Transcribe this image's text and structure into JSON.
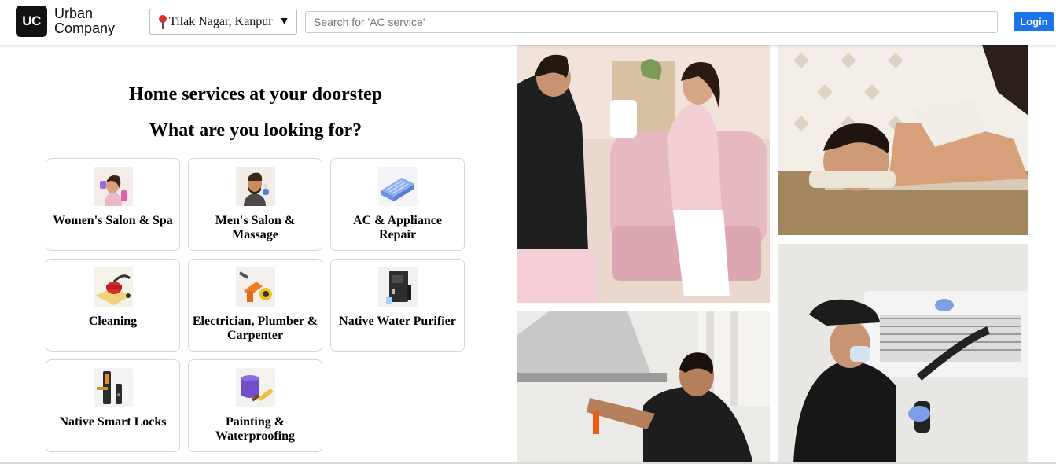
{
  "header": {
    "logo_mark": "UC",
    "logo_line1": "Urban",
    "logo_line2": "Company",
    "location": "Tilak Nagar, Kanpur",
    "location_caret": "▼",
    "search_placeholder": "Search for 'AC service'",
    "login_label": "Login"
  },
  "main": {
    "heading": "Home services at your doorstep",
    "subheading": "What are you looking for?"
  },
  "categories": [
    {
      "label": "Women's Salon & Spa",
      "icon": "women-salon-icon"
    },
    {
      "label": "Men's Salon & Massage",
      "icon": "men-salon-icon"
    },
    {
      "label": "AC & Appliance Repair",
      "icon": "ac-repair-icon"
    },
    {
      "label": "Cleaning",
      "icon": "cleaning-icon"
    },
    {
      "label": "Electrician, Plumber & Carpenter",
      "icon": "electrician-tools-icon"
    },
    {
      "label": "Native Water Purifier",
      "icon": "water-purifier-icon"
    },
    {
      "label": "Native Smart Locks",
      "icon": "smart-lock-icon"
    },
    {
      "label": "Painting & Waterproofing",
      "icon": "paint-icon"
    }
  ],
  "colors": {
    "login_button": "#1a73e8",
    "logo_background": "#111111",
    "uniform": "#1c1c1c"
  }
}
